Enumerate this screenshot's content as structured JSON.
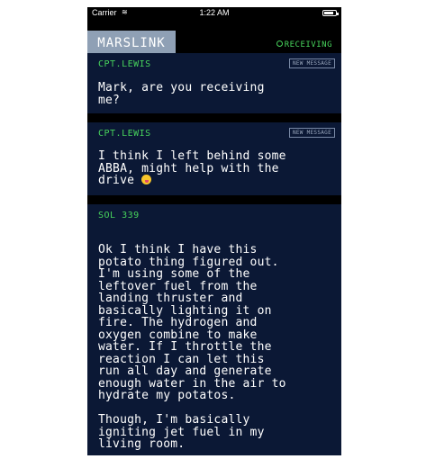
{
  "status_bar": {
    "carrier": "Carrier",
    "time": "1:22 AM"
  },
  "header": {
    "title": "MARSLINK",
    "status": "RECEIVING"
  },
  "messages": [
    {
      "sender": "CPT.LEWIS",
      "badge": "NEW MESSAGE",
      "text": "Mark, are you receiving\nme?"
    },
    {
      "sender": "CPT.LEWIS",
      "badge": "NEW MESSAGE",
      "text": "I think I left behind some\nABBA, might help with the\ndrive "
    },
    {
      "sender": "SOL 339",
      "text": "Ok I think I have this\npotato thing figured out.\nI'm using some of the\nleftover fuel from the\nlanding thruster and\nbasically lighting it on\nfire. The hydrogen and\noxygen combine to make\nwater. If I throttle the\nreaction I can let this\nrun all day and generate\nenough water in the air to\nhydrate my potatos.\n\nThough, I'm basically\nigniting jet fuel in my\nliving room."
    }
  ],
  "colors": {
    "accent": "#47d35c",
    "panel": "#0b1835",
    "title_tab": "#8fa0b5"
  },
  "icons": {
    "wifi": "wifi-icon",
    "battery": "battery-icon",
    "emoji": "tongue-out-emoji"
  }
}
